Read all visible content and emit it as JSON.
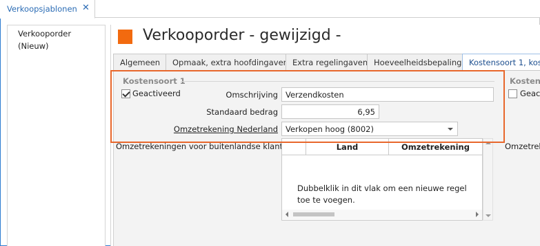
{
  "doc_tab": {
    "label": "Verkoopsjablonen",
    "close": "✕"
  },
  "nav": {
    "item": "Verkooporder (Nieuw)"
  },
  "page": {
    "title": "Verkooporder - gewijzigd -",
    "accent": "#f26a0f"
  },
  "tabs": [
    {
      "label": "Algemeen"
    },
    {
      "label": "Opmaak, extra hoofdingaven"
    },
    {
      "label": "Extra regelingaven"
    },
    {
      "label": "Hoeveelheidsbepaling"
    },
    {
      "label": "Kostensoort 1, kost"
    }
  ],
  "group1": {
    "title": "Kostensoort 1",
    "activated_label": "Geactiveerd",
    "activated": true,
    "description_label": "Omschrijving",
    "description_value": "Verzendkosten",
    "amount_label": "Standaard bedrag",
    "amount_value": "6,95",
    "account_label": "Omzetrekening Nederland",
    "account_value": "Verkopen hoog (8002)"
  },
  "group2": {
    "title": "Kostens",
    "activated_label": "Geact",
    "activated": false
  },
  "foreign": {
    "label": "Omzetrekeningen voor buitenlandse klanten",
    "right_label": "Omzetrek",
    "columns": [
      "Land",
      "Omzetrekening"
    ],
    "empty_text": "Dubbelklik in dit vlak om een nieuwe regel toe te voegen."
  },
  "colors": {
    "highlight": "#e8662a",
    "active_tab": "#1d4f8f"
  }
}
